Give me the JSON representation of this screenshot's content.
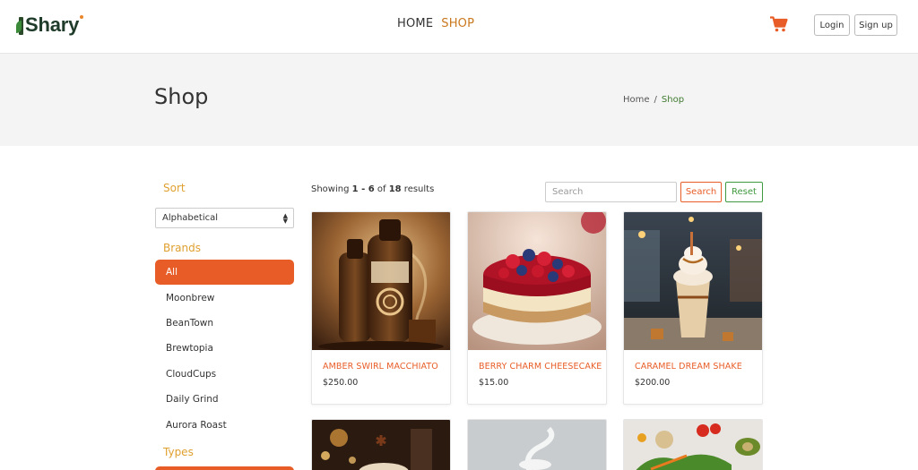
{
  "header": {
    "logo_text": "Shary",
    "nav": [
      {
        "label": "HOME",
        "active": false
      },
      {
        "label": "SHOP",
        "active": true
      }
    ],
    "cart_icon": "shopping-cart-icon",
    "login_label": "Login",
    "signup_label": "Sign up"
  },
  "banner": {
    "title": "Shop",
    "breadcrumb": {
      "home": "Home",
      "separator": "/",
      "current": "Shop"
    }
  },
  "sidebar": {
    "sort_heading": "Sort",
    "sort_selected": "Alphabetical",
    "brands_heading": "Brands",
    "brands": [
      "All",
      "Moonbrew",
      "BeanTown",
      "Brewtopia",
      "CloudCups",
      "Daily Grind",
      "Aurora Roast"
    ],
    "active_brand": "All",
    "types_heading": "Types"
  },
  "toolbar": {
    "showing_prefix": "Showing",
    "range": "1 - 6",
    "of_word": "of",
    "total": "18",
    "results_word": "results",
    "search_placeholder": "Search",
    "search_button": "Search",
    "reset_button": "Reset"
  },
  "products": [
    {
      "name": "AMBER SWIRL MACCHIATO",
      "price": "$250.00"
    },
    {
      "name": "BERRY CHARM CHEESECAKE",
      "price": "$15.00"
    },
    {
      "name": "CARAMEL DREAM SHAKE",
      "price": "$200.00"
    }
  ],
  "colors": {
    "accent": "#e85d27",
    "heading_gold": "#e0a030",
    "nav_active": "#c9781e",
    "reset_green": "#3f9a3f"
  }
}
